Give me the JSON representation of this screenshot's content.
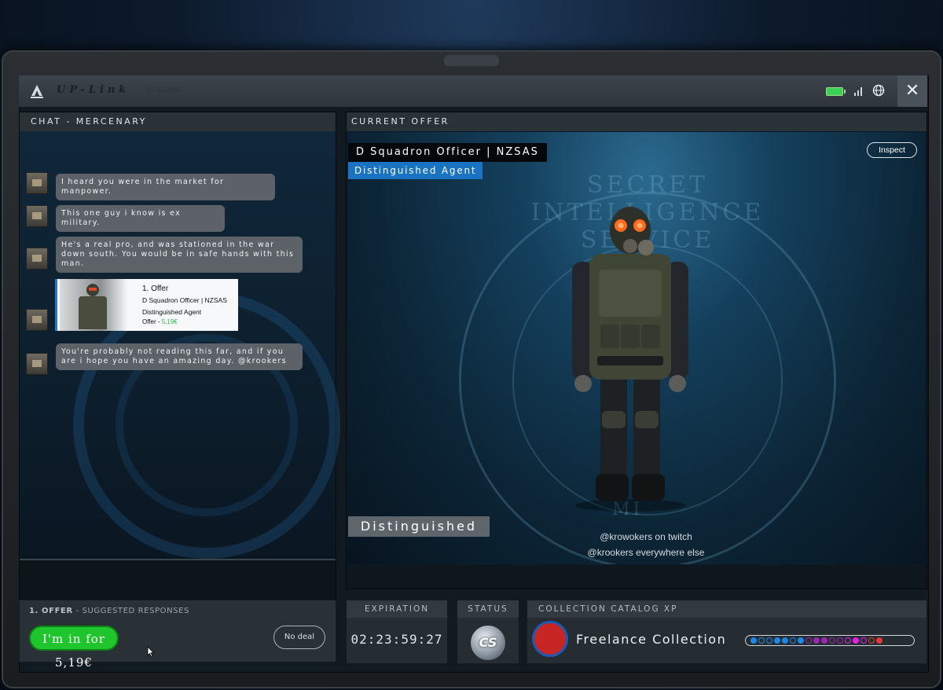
{
  "window": {
    "app_title": "UP-Link",
    "version": "v1.0.2000",
    "close_label": "✕"
  },
  "chat": {
    "header": "CHAT - MERCENARY",
    "messages": [
      "I heard you were in the market for manpower.",
      "This one guy i know is ex military.",
      "He's a real pro, and was stationed in the war down south. You would be in safe hands with this man.",
      "You're probably not reading this far, and if you are i hope you have an amazing day. @krookers"
    ],
    "offer_card": {
      "number": "1.  Offer",
      "name": "D Squadron Officer | NZSAS",
      "rarity": "Distinguished Agent",
      "price_label": "Offer - ",
      "price": "5,19€"
    }
  },
  "responses": {
    "label_bold": "1. OFFER",
    "label_rest": " - SUGGESTED RESPONSES",
    "accept": "I'm in for 5,19€",
    "decline": "No deal"
  },
  "offer": {
    "header": "CURRENT OFFER",
    "item_name": "D Squadron Officer | NZSAS",
    "item_rarity": "Distinguished Agent",
    "inspect": "Inspect",
    "rarity_tag": "Distinguished",
    "seal_text": "SECRET INTELLIGENCE SERVICE",
    "seal_bottom": "MI",
    "credit_1": "@krowokers on twitch",
    "credit_2": "@krookers everywhere else"
  },
  "expiration": {
    "title": "EXPIRATION",
    "time": "02:23:59:27"
  },
  "status": {
    "title": "STATUS",
    "badge": "CS"
  },
  "collection": {
    "title": "COLLECTION CATALOG XP",
    "name": "Freelance Collection",
    "xp_dots": [
      {
        "color": "#1e88e5",
        "filled": true
      },
      {
        "color": "#1e88e5",
        "filled": false
      },
      {
        "color": "#1e88e5",
        "filled": false
      },
      {
        "color": "#1e88e5",
        "filled": true
      },
      {
        "color": "#1e88e5",
        "filled": true
      },
      {
        "color": "#1e88e5",
        "filled": false
      },
      {
        "color": "#1e88e5",
        "filled": true
      },
      {
        "color": "#9c27b0",
        "filled": false
      },
      {
        "color": "#9c27b0",
        "filled": true
      },
      {
        "color": "#9c27b0",
        "filled": true
      },
      {
        "color": "#9c27b0",
        "filled": false
      },
      {
        "color": "#9c27b0",
        "filled": false
      },
      {
        "color": "#e91ee6",
        "filled": false
      },
      {
        "color": "#e91ee6",
        "filled": true
      },
      {
        "color": "#e91ee6",
        "filled": false
      },
      {
        "color": "#e53935",
        "filled": false
      },
      {
        "color": "#e53935",
        "filled": true
      }
    ]
  },
  "colors": {
    "accent_blue": "#1a73c2",
    "accept_green": "#1fc52c",
    "price_green": "#2bb84a"
  }
}
